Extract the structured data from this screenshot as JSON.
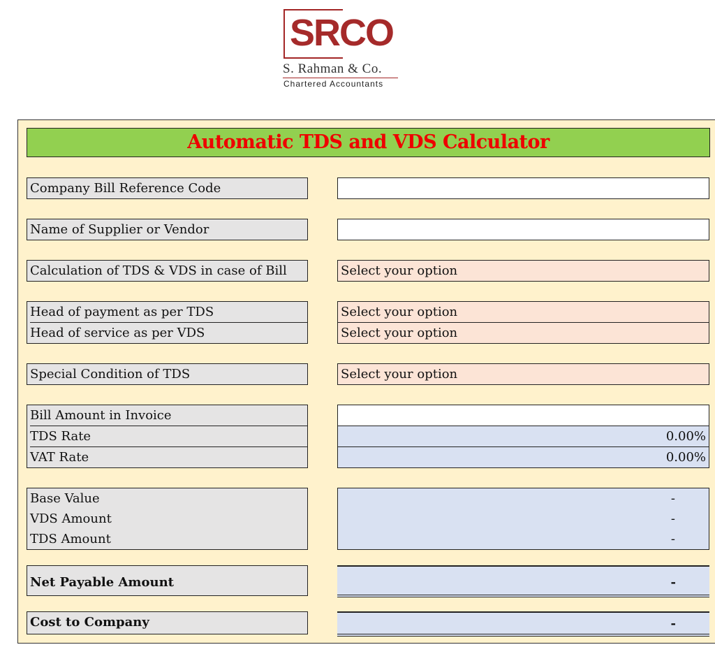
{
  "logo": {
    "mark": "SRCO",
    "firm_name": "S. Rahman & Co.",
    "subtitle": "Chartered Accountants",
    "brand_color": "#a52a2a"
  },
  "calculator": {
    "title": "Automatic TDS and VDS Calculator",
    "title_color": "#ee0000",
    "title_bg": "#92d050",
    "fields": {
      "bill_ref": {
        "label": "Company Bill Reference Code",
        "value": ""
      },
      "supplier": {
        "label": "Name of Supplier or Vendor",
        "value": ""
      },
      "calc_case": {
        "label": "Calculation of TDS & VDS in case of Bill",
        "value": "Select your option"
      },
      "head_tds": {
        "label": "Head of payment as per TDS",
        "value": "Select your option"
      },
      "head_vds": {
        "label": "Head of service as per VDS",
        "value": "Select your option"
      },
      "special_tds": {
        "label": "Special Condition of TDS",
        "value": "Select your option"
      },
      "bill_amount": {
        "label": "Bill Amount in Invoice",
        "value": ""
      },
      "tds_rate": {
        "label": "TDS Rate",
        "value": "0.00%"
      },
      "vat_rate": {
        "label": "VAT Rate",
        "value": "0.00%"
      },
      "base_value": {
        "label": "Base Value",
        "value": "-"
      },
      "vds_amount": {
        "label": "VDS Amount",
        "value": "-"
      },
      "tds_amount": {
        "label": "TDS Amount",
        "value": "-"
      },
      "net_payable": {
        "label": "Net Payable Amount",
        "value": "-"
      },
      "cost_to_company": {
        "label": "Cost to Company",
        "value": "-"
      }
    }
  }
}
